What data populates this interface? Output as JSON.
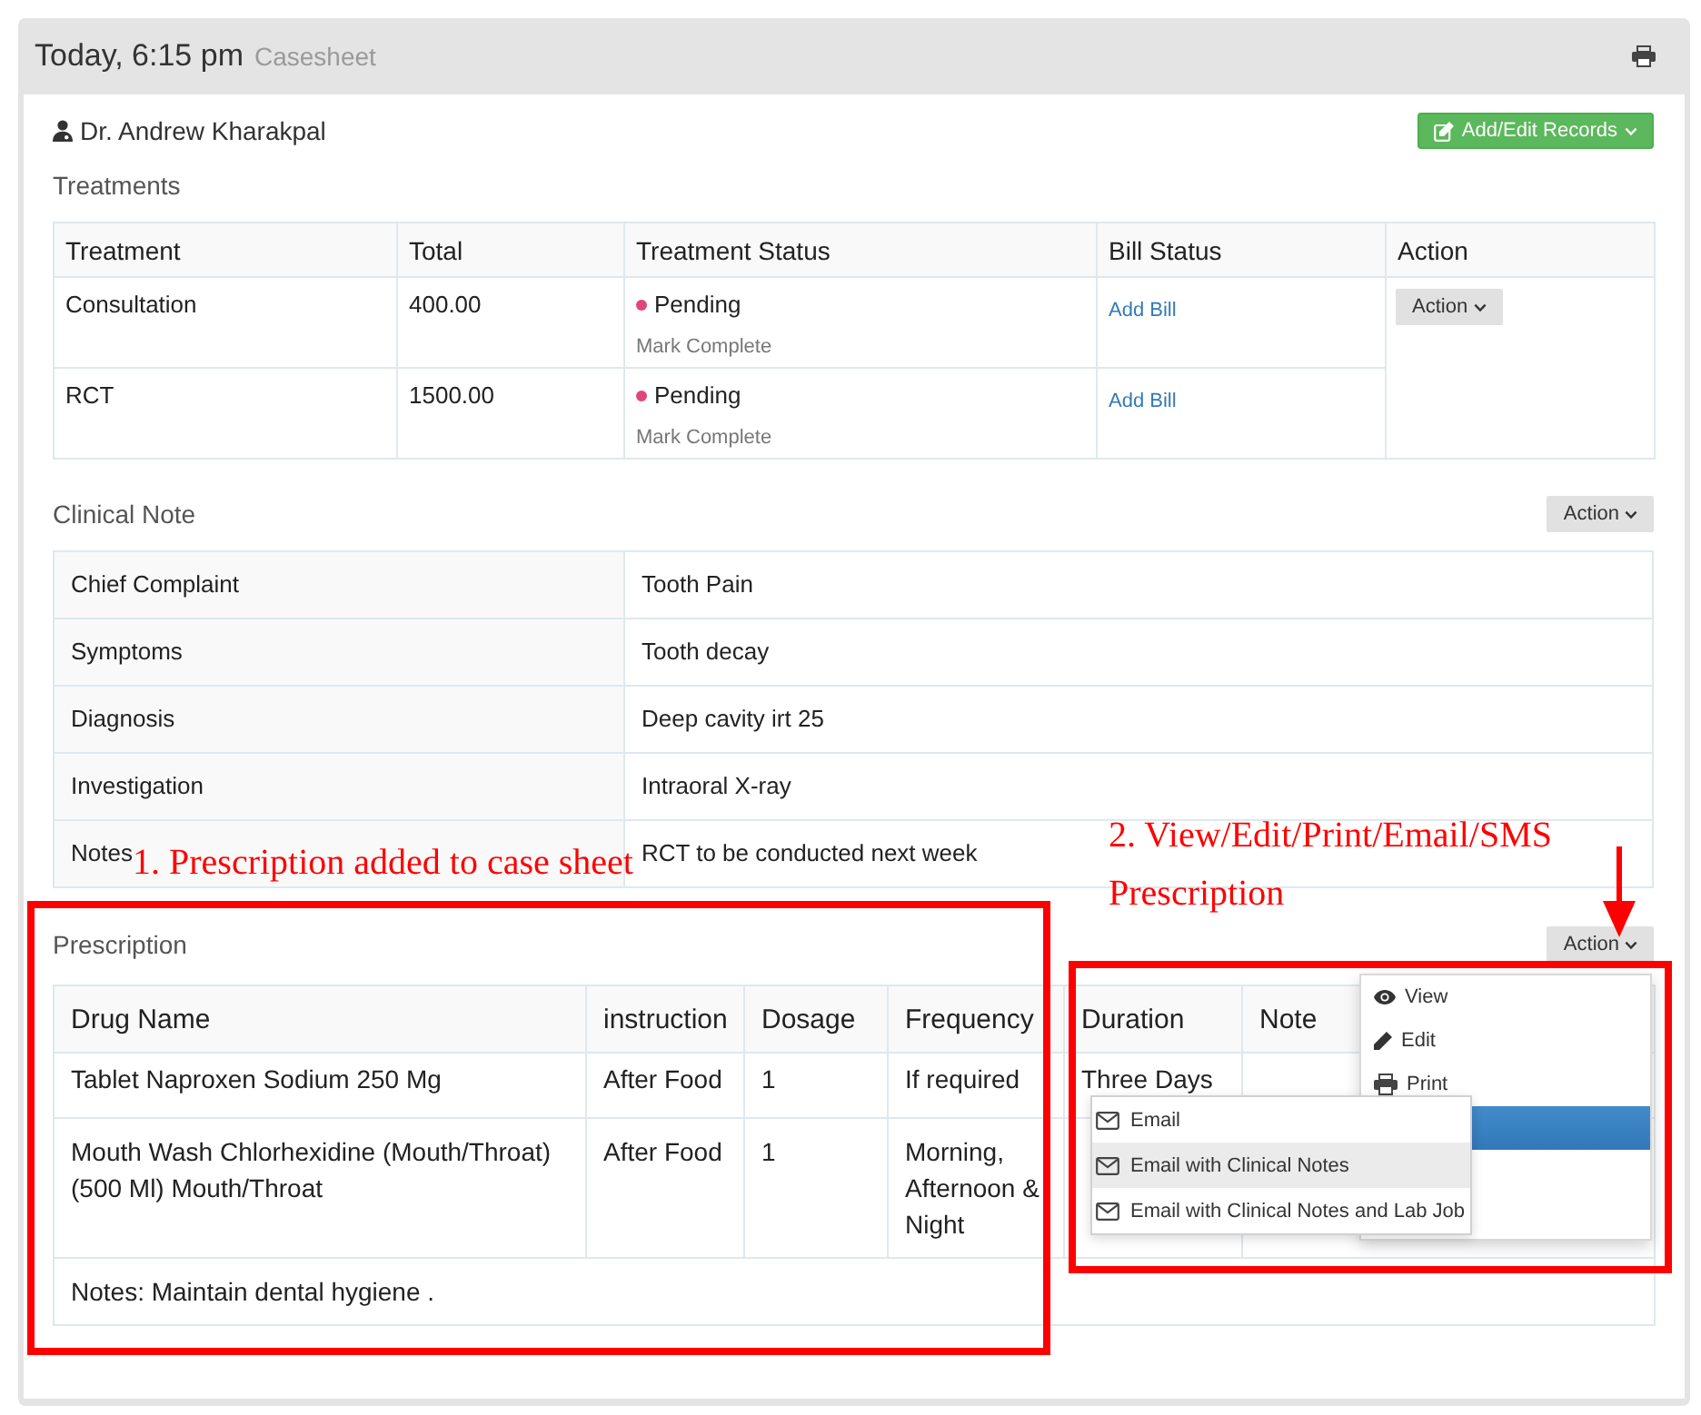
{
  "header": {
    "title": "Today, 6:15 pm",
    "subtitle": "Casesheet"
  },
  "doctor": {
    "name": "Dr. Andrew Kharakpal"
  },
  "add_button": {
    "label": "Add/Edit Records"
  },
  "treatments": {
    "title": "Treatments",
    "columns": [
      "Treatment",
      "Total",
      "Treatment Status",
      "Bill Status",
      "Action"
    ],
    "rows": [
      {
        "treatment": "Consultation",
        "total": "400.00",
        "status": "Pending",
        "status_link": "Mark Complete",
        "bill_link": "Add Bill"
      },
      {
        "treatment": "RCT",
        "total": "1500.00",
        "status": "Pending",
        "status_link": "Mark Complete",
        "bill_link": "Add Bill"
      }
    ],
    "action_button": "Action"
  },
  "clinical_note": {
    "title": "Clinical Note",
    "action_button": "Action",
    "rows": [
      {
        "label": "Chief Complaint",
        "value": "Tooth Pain"
      },
      {
        "label": "Symptoms",
        "value": "Tooth decay"
      },
      {
        "label": "Diagnosis",
        "value": "Deep cavity irt 25"
      },
      {
        "label": "Investigation",
        "value": "Intraoral X-ray"
      },
      {
        "label": "Notes",
        "value": "RCT to be conducted next week"
      }
    ]
  },
  "prescription": {
    "title": "Prescription",
    "action_button": "Action",
    "columns": [
      "Drug Name",
      "instruction",
      "Dosage",
      "Frequency",
      "Duration",
      "Note"
    ],
    "rows": [
      {
        "cells": [
          "Tablet Naproxen Sodium 250 Mg",
          "After Food",
          "1",
          "If required",
          "Three Days"
        ]
      },
      {
        "cells": [
          "Mouth Wash Chlorhexidine (Mouth/Throat) (500 Ml) Mouth/Throat",
          "After Food",
          "1",
          "Morning, Afternoon & Night"
        ]
      }
    ],
    "notes": "Notes: Maintain dental hygiene ."
  },
  "action_menu": {
    "items": [
      {
        "kind": "view",
        "label": "View",
        "selected": false
      },
      {
        "kind": "edit",
        "label": "Edit",
        "selected": false
      },
      {
        "kind": "print",
        "label": "Print",
        "selected": false
      },
      {
        "kind": "group",
        "selected": true
      }
    ],
    "submenu": [
      {
        "label": "Email",
        "selected": false
      },
      {
        "label": "Email with Clinical Notes",
        "selected": true
      },
      {
        "label": "Email with Clinical Notes and Lab Job",
        "selected": false
      }
    ]
  },
  "annotations": [
    {
      "text": "1. Prescription added to case sheet"
    },
    {
      "text": "2. View/Edit/Print/Email/SMS Prescription"
    }
  ]
}
